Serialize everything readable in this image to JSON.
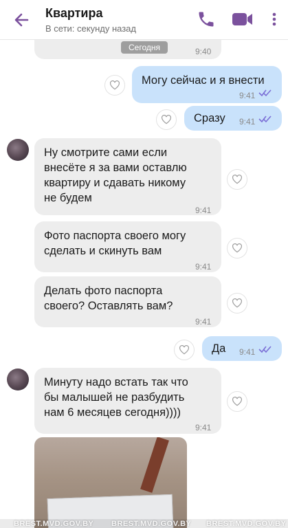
{
  "header": {
    "title": "Квартира",
    "status": "В сети: секунду назад",
    "back_icon": "arrow-left-icon",
    "call_icon": "phone-icon",
    "video_icon": "video-camera-icon",
    "menu_icon": "more-vertical-icon"
  },
  "colors": {
    "accent": "#7b519d",
    "incoming_bubble": "#ededed",
    "outgoing_bubble": "#c9e2fb",
    "read_ticks": "#7b6fd6"
  },
  "date_separator": "Сегодня",
  "messages": [
    {
      "direction": "in",
      "text": "",
      "time": "9:40"
    },
    {
      "direction": "out",
      "text": "Могу сейчас и я внести",
      "time": "9:41"
    },
    {
      "direction": "out",
      "text": "Сразу",
      "time": "9:41"
    },
    {
      "direction": "in",
      "text": "Ну смотрите сами если\nвнесёте я за вами оставлю\nквартиру и сдавать никому\nне будем",
      "time": "9:41"
    },
    {
      "direction": "in",
      "text": "Фото паспорта своего могу\nсделать и скинуть вам",
      "time": "9:41"
    },
    {
      "direction": "in",
      "text": "Делать фото паспорта\nсвоего? Оставлять вам?",
      "time": "9:41"
    },
    {
      "direction": "out",
      "text": "Да",
      "time": "9:41"
    },
    {
      "direction": "in",
      "text": "Минуту надо встать так что\nбы малышей не разбудить\nнам 6 месяцев сегодня))))",
      "time": "9:41"
    }
  ],
  "watermarks": [
    "BREST.MVD.GOV.BY",
    "BREST.MVD.GOV.BY",
    "BREST.MVD.GOV.BY"
  ]
}
